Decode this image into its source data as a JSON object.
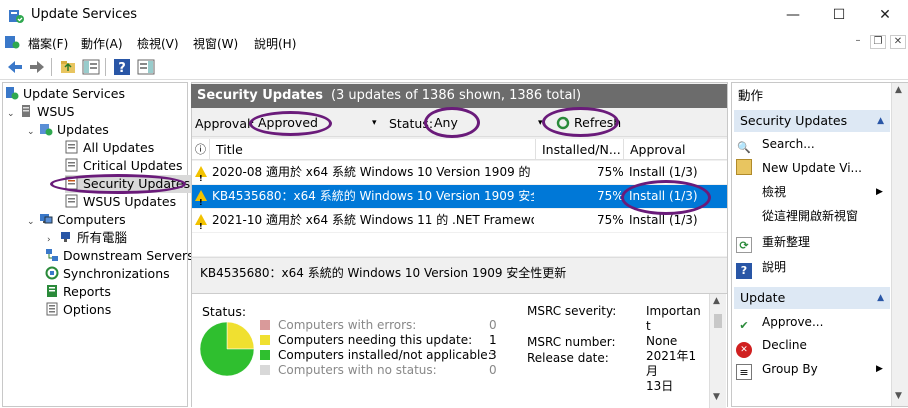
{
  "window": {
    "title": "Update Services",
    "minimize": "—",
    "maximize": "☐",
    "close": "✕"
  },
  "menu": {
    "items": [
      "檔案(F)",
      "動作(A)",
      "檢視(V)",
      "視窗(W)",
      "說明(H)"
    ]
  },
  "tree": {
    "root": "Update Services",
    "server": "WSUS",
    "updates": "Updates",
    "all_updates": "All Updates",
    "critical_updates": "Critical Updates",
    "security_updates": "Security Updates",
    "wsus_updates": "WSUS Updates",
    "computers": "Computers",
    "all_computers": "所有電腦",
    "downstream": "Downstream Servers",
    "sync": "Synchronizations",
    "reports": "Reports",
    "options": "Options"
  },
  "center": {
    "header_title": "Security Updates",
    "header_sub": "(3 updates of 1386 shown, 1386 total)",
    "approval_label": "Approval:",
    "approval_value": "Approved",
    "status_label": "Status:",
    "status_value": "Any",
    "refresh_label": "Refresh",
    "columns": {
      "info": "ⓘ",
      "title": "Title",
      "installed": "Installed/N...",
      "approval": "Approval"
    },
    "rows": [
      {
        "title": "2020-08 適用於 x64 系統 Windows 10 Version 1909 的 ...",
        "installed": "75%",
        "approval": "Install (1/3)"
      },
      {
        "title": "KB4535680：x64 系統的 Windows 10 Version 1909 安全...",
        "installed": "75%",
        "approval": "Install (1/3)"
      },
      {
        "title": "2021-10 適用於 x64 系統 Windows 11 的 .NET Framewo...",
        "installed": "75%",
        "approval": "Install (1/3)"
      }
    ],
    "description": "KB4535680：x64 系統的 Windows 10 Version 1909 安全性更新",
    "status_heading": "Status:",
    "legend": [
      {
        "label": "Computers with errors:",
        "value": "0",
        "color": "#d99a9a"
      },
      {
        "label": "Computers needing this update:",
        "value": "1",
        "color": "#f0e030"
      },
      {
        "label": "Computers installed/not applicable:",
        "value": "3",
        "color": "#2fbf2f"
      },
      {
        "label": "Computers with no status:",
        "value": "0",
        "color": "#d8d8d8"
      }
    ],
    "msrc_severity_label": "MSRC severity:",
    "msrc_severity_value_1": "Importan",
    "msrc_severity_value_2": "t",
    "msrc_number_label": "MSRC number:",
    "msrc_number_value": "None",
    "release_label": "Release date:",
    "release_value_1": "2021年1",
    "release_value_2": "月",
    "release_value_3": "13日"
  },
  "actions": {
    "header": "動作",
    "section1": "Security Updates",
    "items1": [
      "Search...",
      "New Update Vi...",
      "檢視",
      "從這裡開啟新視窗",
      "重新整理",
      "說明"
    ],
    "section2": "Update",
    "items2": [
      "Approve...",
      "Decline",
      "Group By"
    ]
  },
  "chart_data": {
    "type": "pie",
    "categories": [
      "Computers with errors",
      "Computers needing this update",
      "Computers installed/not applicable",
      "Computers with no status"
    ],
    "values": [
      0,
      1,
      3,
      0
    ]
  }
}
